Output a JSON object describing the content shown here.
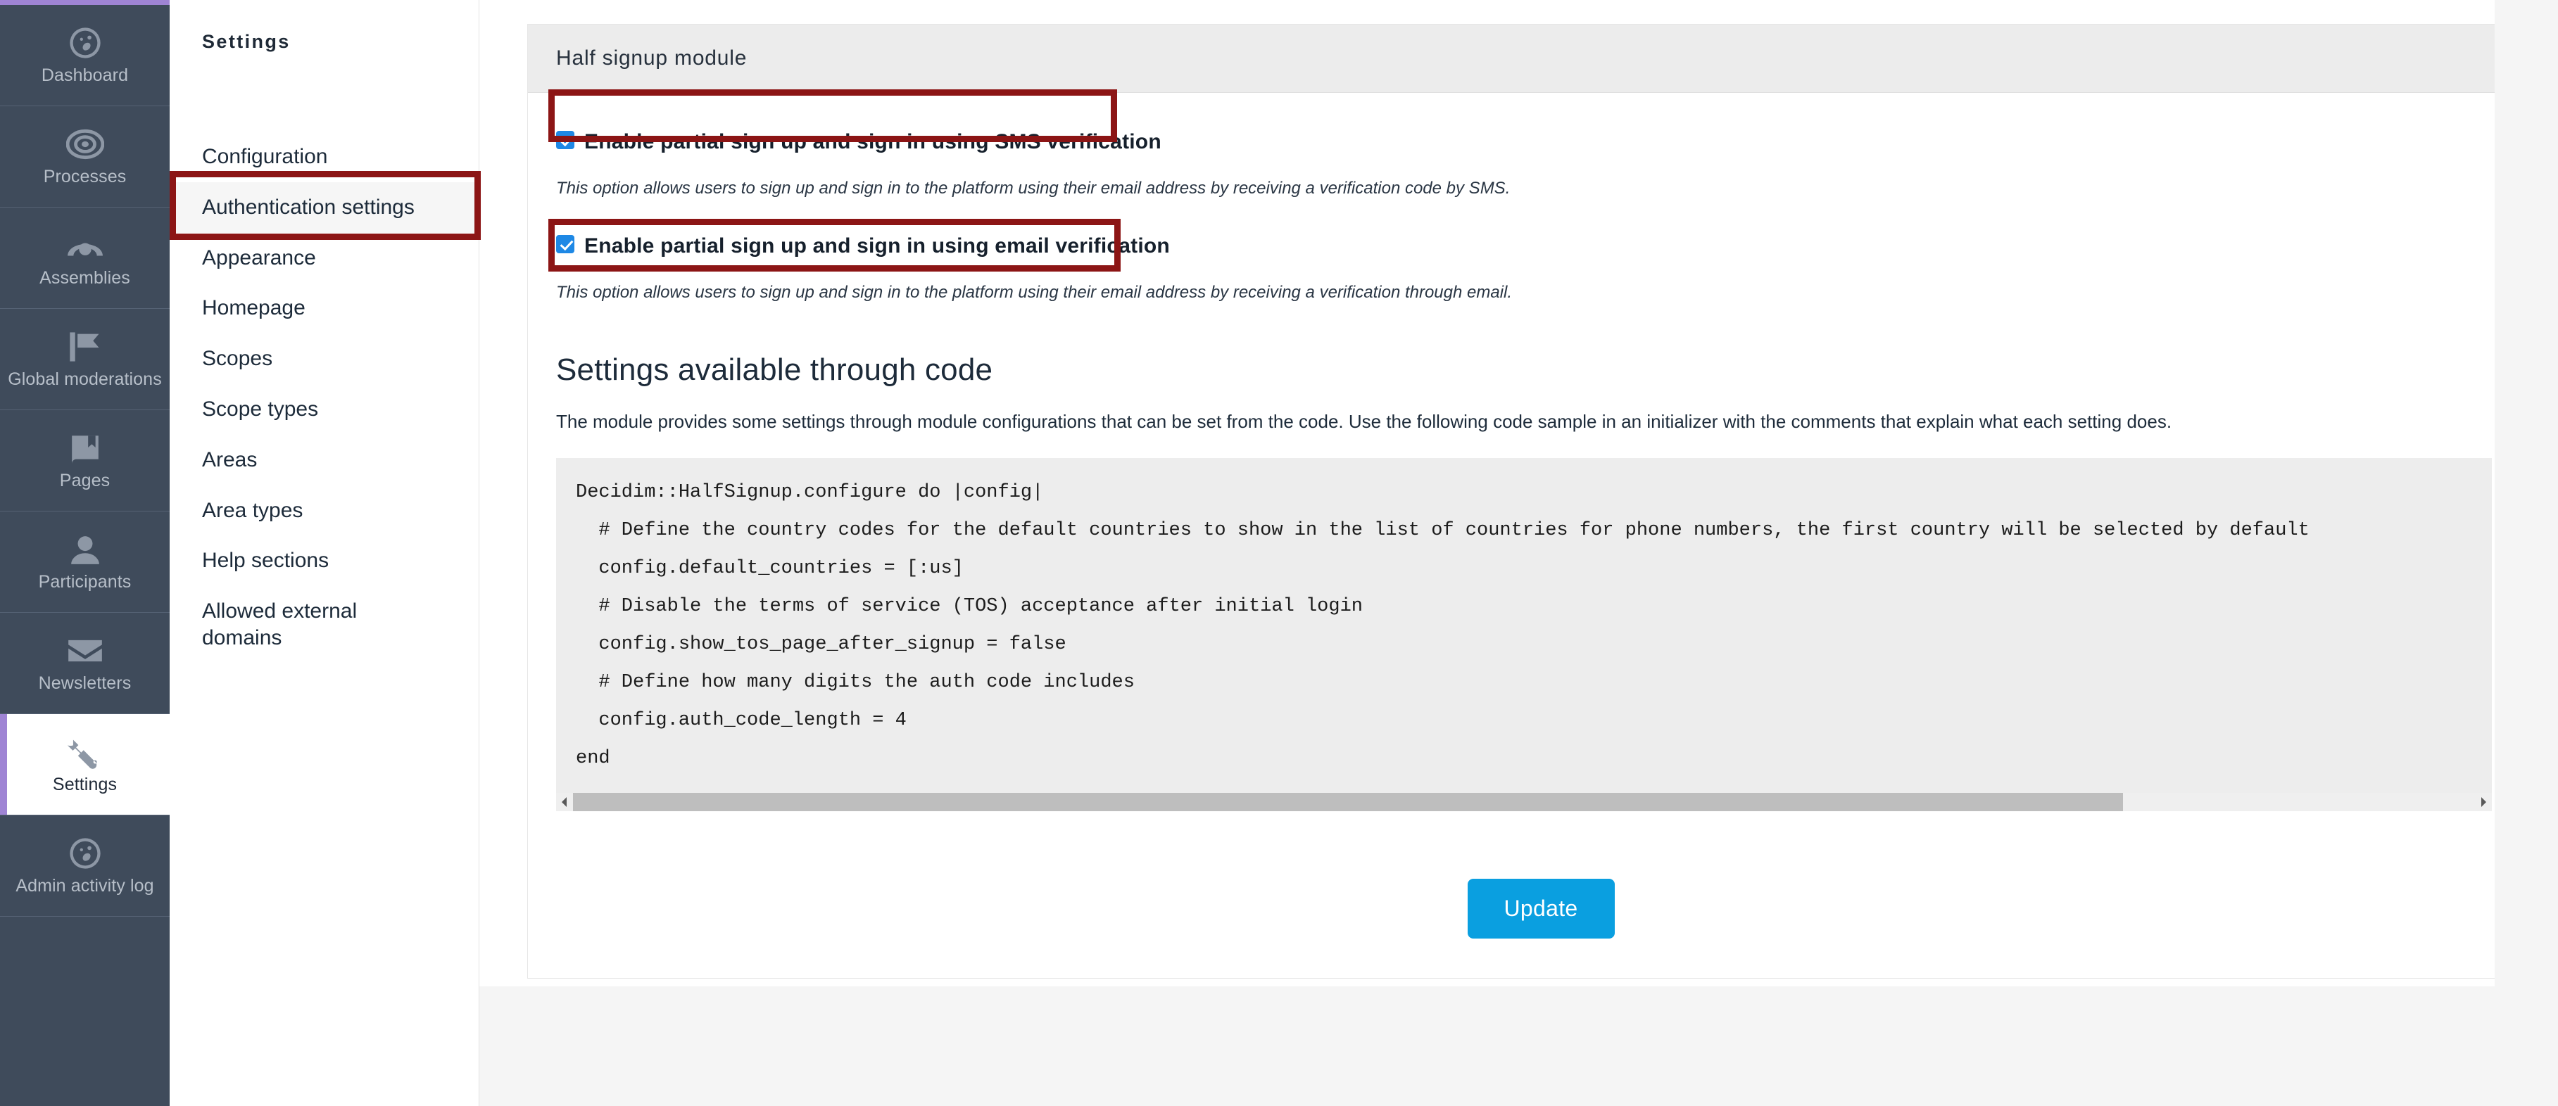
{
  "theme": {
    "sidebar_bg": "#3f4b5b",
    "accent_purple": "#9f84d4",
    "annotation_red": "#8c1515",
    "checkbox_blue": "#1e88e5",
    "button_blue": "#0a9fe0"
  },
  "primary_nav": {
    "items": [
      {
        "label": "Dashboard",
        "icon": "dashboard-icon",
        "active": false
      },
      {
        "label": "Processes",
        "icon": "target-icon",
        "active": false
      },
      {
        "label": "Assemblies",
        "icon": "assembly-icon",
        "active": false
      },
      {
        "label": "Global moderations",
        "icon": "flag-icon",
        "active": false
      },
      {
        "label": "Pages",
        "icon": "book-icon",
        "active": false
      },
      {
        "label": "Participants",
        "icon": "person-icon",
        "active": false
      },
      {
        "label": "Newsletters",
        "icon": "envelope-icon",
        "active": false
      },
      {
        "label": "Settings",
        "icon": "wrench-icon",
        "active": true
      },
      {
        "label": "Admin activity log",
        "icon": "activity-icon",
        "active": false
      }
    ]
  },
  "secondary_nav": {
    "title": "Settings",
    "items": [
      {
        "label": "Configuration",
        "current": false
      },
      {
        "label": "Authentication settings",
        "current": true
      },
      {
        "label": "Appearance",
        "current": false
      },
      {
        "label": "Homepage",
        "current": false
      },
      {
        "label": "Scopes",
        "current": false
      },
      {
        "label": "Scope types",
        "current": false
      },
      {
        "label": "Areas",
        "current": false
      },
      {
        "label": "Area types",
        "current": false
      },
      {
        "label": "Help sections",
        "current": false
      },
      {
        "label": "Allowed external domains",
        "current": false
      }
    ]
  },
  "main": {
    "card_title": "Half signup module",
    "sms_option": {
      "label": "Enable partial sign up and sign in using SMS verification",
      "checked": true,
      "help": "This option allows users to sign up and sign in to the platform using their email address by receiving a verification code by SMS."
    },
    "email_option": {
      "label": "Enable partial sign up and sign in using email verification",
      "checked": true,
      "help": "This option allows users to sign up and sign in to the platform using their email address by receiving a verification through email."
    },
    "code_section": {
      "title": "Settings available through code",
      "paragraph": "The module provides some settings through module configurations that can be set from the code. Use the following code sample in an initializer with the comments that explain what each setting does.",
      "code": "Decidim::HalfSignup.configure do |config|\n  # Define the country codes for the default countries to show in the list of countries for phone numbers, the first country will be selected by default\n  config.default_countries = [:us]\n  # Disable the terms of service (TOS) acceptance after initial login\n  config.show_tos_page_after_signup = false\n  # Define how many digits the auth code includes\n  config.auth_code_length = 4\nend",
      "scroll_left_icon": "scroll-left-arrow-icon",
      "scroll_right_icon": "scroll-right-arrow-icon"
    },
    "update_button": "Update"
  }
}
